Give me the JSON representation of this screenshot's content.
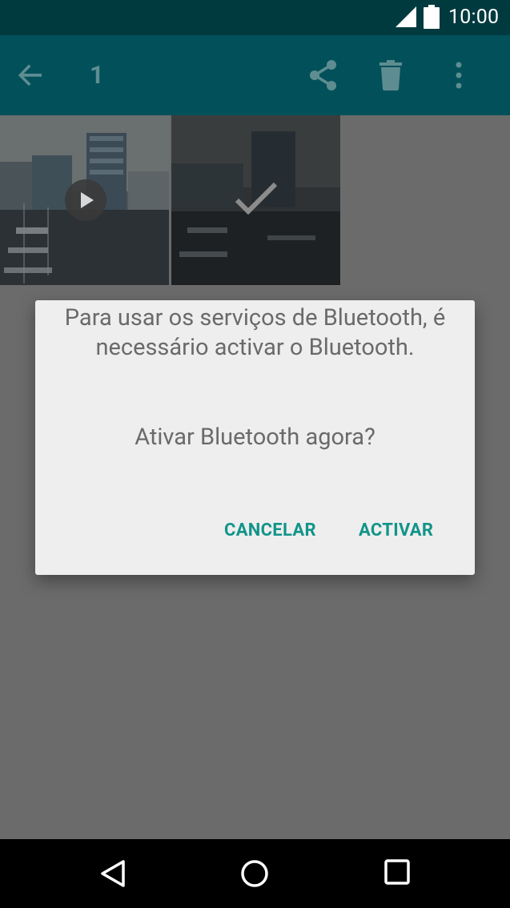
{
  "status_bar": {
    "time": "10:00",
    "icons": [
      "signal-icon",
      "battery-icon"
    ]
  },
  "action_bar": {
    "selected_count": "1",
    "icons": [
      "back-arrow-icon",
      "share-icon",
      "delete-icon",
      "more-vert-icon"
    ]
  },
  "gallery": {
    "items": [
      {
        "type": "video",
        "selected": false,
        "icon": "play-icon"
      },
      {
        "type": "photo",
        "selected": true,
        "icon": "check-icon"
      }
    ]
  },
  "dialog": {
    "message": "Para usar os serviços de Bluetooth, é necessário activar o Bluetooth.",
    "question": "Ativar Bluetooth agora?",
    "cancel_label": "CANCELAR",
    "activate_label": "ACTIVAR"
  },
  "nav_bar": {
    "icons": [
      "nav-back-icon",
      "nav-home-icon",
      "nav-recents-icon"
    ]
  },
  "colors": {
    "status_bar": "#003a3f",
    "action_bar": "#02515a",
    "accent": "#12948a",
    "scrim": "#6b6b6b",
    "dialog_bg": "#eeeeee"
  }
}
